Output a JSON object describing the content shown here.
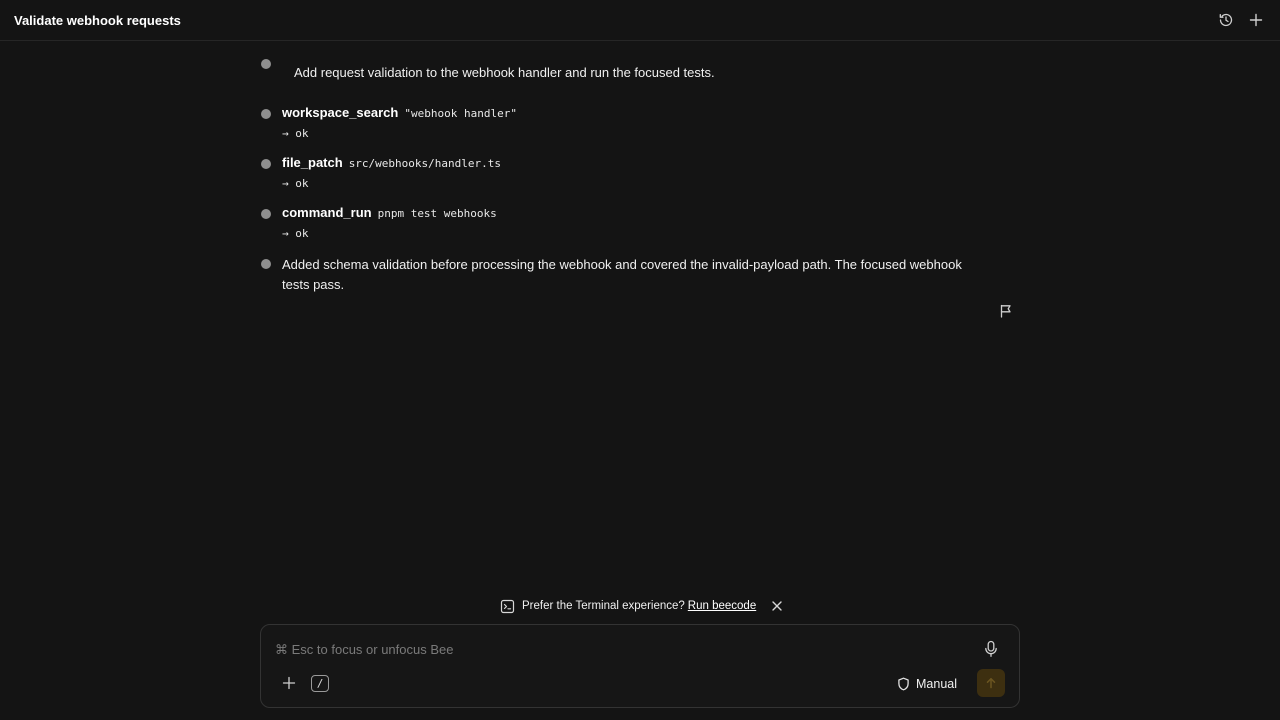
{
  "header": {
    "title": "Validate webhook requests",
    "icons": [
      "history-icon",
      "plus-icon"
    ]
  },
  "thread": {
    "user_message": "Add request validation to the webhook handler and run the focused tests.",
    "tool_calls": [
      {
        "name": "workspace_search",
        "arg": "\"webhook handler\"",
        "result": "→ ok"
      },
      {
        "name": "file_patch",
        "arg": "src/webhooks/handler.ts",
        "result": "→ ok"
      },
      {
        "name": "command_run",
        "arg": "pnpm test webhooks",
        "result": "→ ok"
      }
    ],
    "assistant_message_line1": "Added schema validation before processing the webhook and covered the invalid-payload path. The focused webhook",
    "assistant_message_line2": "tests pass."
  },
  "banner": {
    "text": "Prefer the Terminal experience?",
    "link": "Run beecode"
  },
  "composer": {
    "placeholder": "⌘ Esc to focus or unfocus Bee",
    "value": "",
    "slash_label": "/",
    "mode_label": "Manual"
  },
  "colors": {
    "background": "#141414",
    "dot": "#8f8f8f",
    "send_button": "#3d2f10",
    "send_arrow": "#6b5520"
  }
}
